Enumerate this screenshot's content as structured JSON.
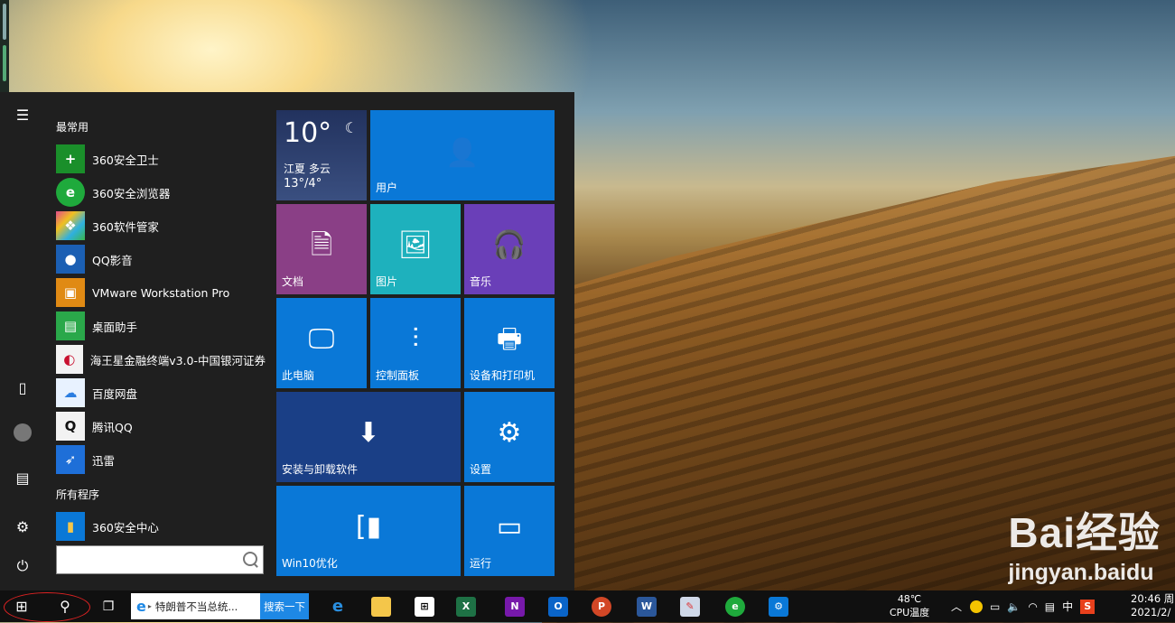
{
  "start_menu": {
    "section_frequent": "最常用",
    "section_all": "所有程序",
    "apps": [
      {
        "label": "360安全卫士",
        "icon": "360-security-icon",
        "color": "#1a8f2a",
        "glyph": "+"
      },
      {
        "label": "360安全浏览器",
        "icon": "360-browser-icon",
        "color": "#1faa3c",
        "glyph": "e"
      },
      {
        "label": "360软件管家",
        "icon": "360-software-manager-icon",
        "color": "#e24a8a",
        "glyph": "❖"
      },
      {
        "label": "QQ影音",
        "icon": "qq-player-icon",
        "color": "#1b5fb3",
        "glyph": "●"
      },
      {
        "label": "VMware Workstation Pro",
        "icon": "vmware-icon",
        "color": "#e08a14",
        "glyph": "▣"
      },
      {
        "label": "桌面助手",
        "icon": "desktop-assistant-icon",
        "color": "#2aa84a",
        "glyph": "▤"
      },
      {
        "label": "海王星金融终端v3.0-中国银河证券",
        "icon": "neptune-finance-icon",
        "color": "#c8102e",
        "glyph": "◐"
      },
      {
        "label": "百度网盘",
        "icon": "baidu-netdisk-icon",
        "color": "#2b7de0",
        "glyph": "☁"
      },
      {
        "label": "腾讯QQ",
        "icon": "tencent-qq-icon",
        "color": "#111111",
        "glyph": "🐧"
      },
      {
        "label": "迅雷",
        "icon": "thunder-icon",
        "color": "#1e6fd8",
        "glyph": "➶"
      }
    ],
    "all_apps": [
      {
        "label": "360安全中心",
        "icon": "folder-icon",
        "color": "#d8a93a",
        "glyph": "▮"
      }
    ],
    "search_placeholder": ""
  },
  "tiles": {
    "weather": {
      "temp": "10°",
      "city": "江夏",
      "cond": "多云",
      "range": "13°/4°",
      "color": "#2a3a6a"
    },
    "user": {
      "label": "用户",
      "color": "#0a78d7"
    },
    "documents": {
      "label": "文档",
      "color": "#8a3f86"
    },
    "pictures": {
      "label": "图片",
      "color": "#1eb1bd"
    },
    "music": {
      "label": "音乐",
      "color": "#6a3fb8"
    },
    "this_pc": {
      "label": "此电脑",
      "color": "#0a78d7"
    },
    "control_panel": {
      "label": "控制面板",
      "color": "#0a78d7"
    },
    "devices_printers": {
      "label": "设备和打印机",
      "color": "#0a78d7"
    },
    "install_uninstall": {
      "label": "安装与卸载软件",
      "color": "#1a3f86"
    },
    "settings": {
      "label": "设置",
      "color": "#0a78d7"
    },
    "win10_optimize": {
      "label": "Win10优化",
      "color": "#0a78d7"
    },
    "run": {
      "label": "运行",
      "color": "#0a78d7"
    }
  },
  "taskbar": {
    "news_text": "特朗普不当总统...",
    "search_button": "搜索一下",
    "cpu_temp": "48℃",
    "cpu_label": "CPU温度",
    "ime": "中",
    "time": "20:46 周",
    "date": "2021/2/"
  },
  "watermark": {
    "brand": "Bai经验",
    "url": "jingyan.baidu"
  }
}
